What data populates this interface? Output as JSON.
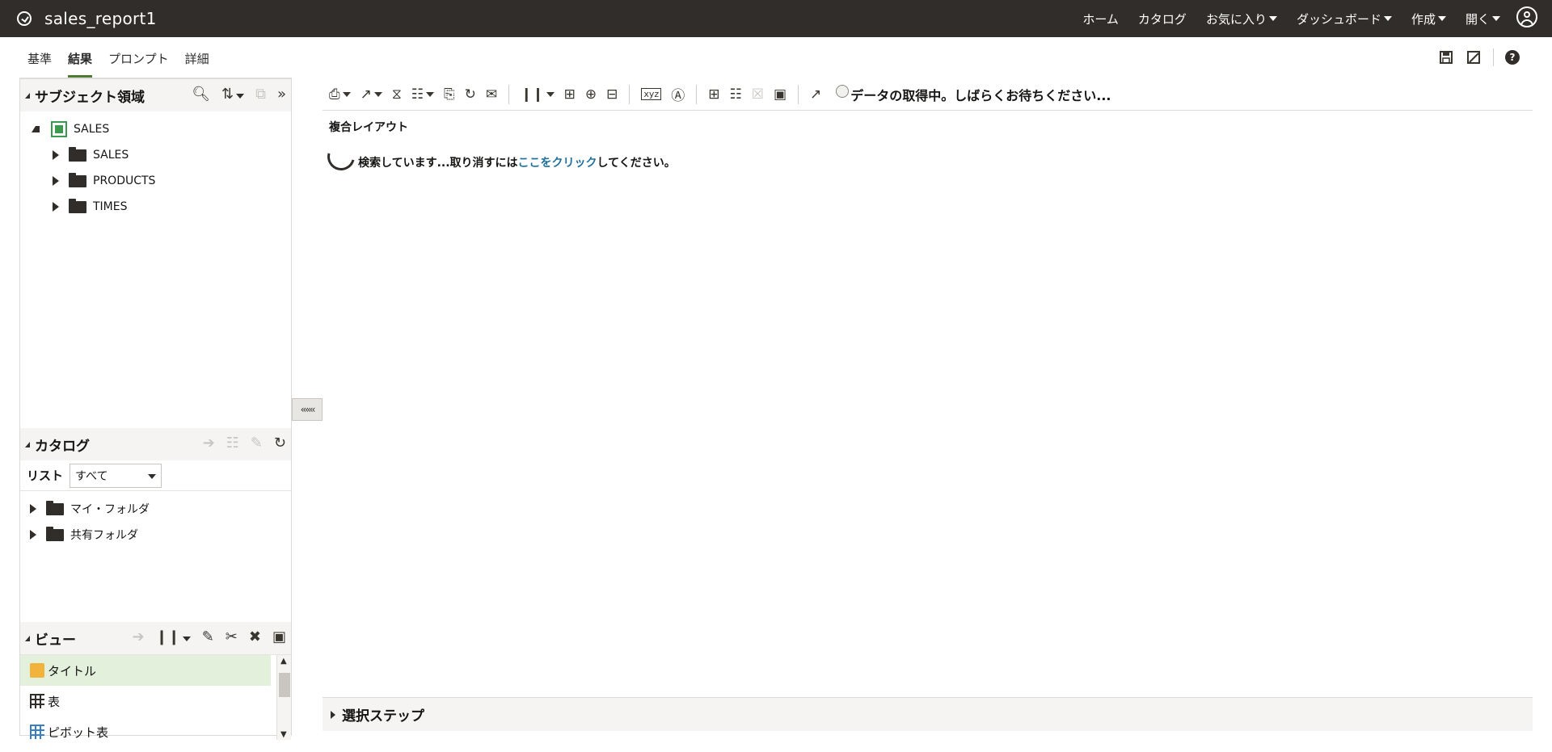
{
  "header": {
    "title": "sales_report1",
    "nav": [
      {
        "label": "ホーム"
      },
      {
        "label": "カタログ"
      },
      {
        "label": "お気に入り"
      },
      {
        "label": "ダッシュボード"
      },
      {
        "label": "作成"
      },
      {
        "label": "開く"
      }
    ]
  },
  "tabs": [
    {
      "label": "基準"
    },
    {
      "label": "結果"
    },
    {
      "label": "プロンプト"
    },
    {
      "label": "詳細"
    }
  ],
  "subject_area": {
    "title": "サブジェクト領域",
    "root": "SALES",
    "children": [
      "SALES",
      "PRODUCTS",
      "TIMES"
    ]
  },
  "catalog": {
    "title": "カタログ",
    "list_label": "リスト",
    "list_value": "すべて",
    "folders": [
      "マイ・フォルダ",
      "共有フォルダ"
    ]
  },
  "views": {
    "title": "ビュー",
    "items": [
      "タイトル",
      "表",
      "ピボット表"
    ]
  },
  "main": {
    "loading_message": "データの取得中。しばらくお待ちください...",
    "layout_title": "複合レイアウト",
    "searching_prefix": "検索しています...取り消すには",
    "cancel_link": "ここをクリック",
    "searching_suffix": "してください。",
    "selection_steps": "選択ステップ"
  },
  "colors": {
    "topbar": "#312d2a",
    "active_tab": "#4e7a32",
    "link": "#1f6f9c",
    "selected_view": "#e2f0dc"
  }
}
